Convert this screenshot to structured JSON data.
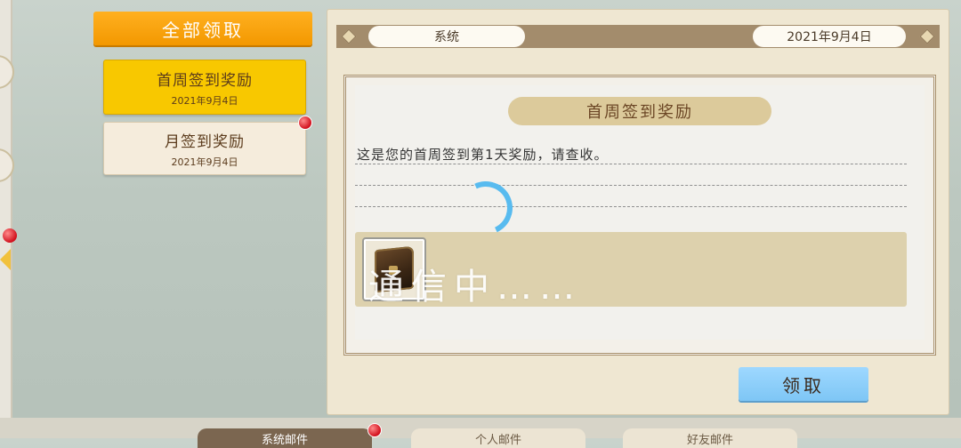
{
  "claim_all_label": "全部领取",
  "mail_list": [
    {
      "title": "首周签到奖励",
      "date": "2021年9月4日",
      "selected": true
    },
    {
      "title": "月签到奖励",
      "date": "2021年9月4日",
      "selected": false
    }
  ],
  "mail": {
    "sender": "系统",
    "date": "2021年9月4日",
    "title": "首周签到奖励",
    "body": "这是您的首周签到第1天奖励，请查收。"
  },
  "loading_text": "通信中……",
  "claim_label": "领取",
  "bottom_tabs": [
    "系统邮件",
    "个人邮件",
    "好友邮件"
  ],
  "colors": {
    "accent_orange": "#f39800",
    "selected_yellow": "#f8c800",
    "claim_blue": "#7ec6f5",
    "spinner": "#58bbef"
  }
}
